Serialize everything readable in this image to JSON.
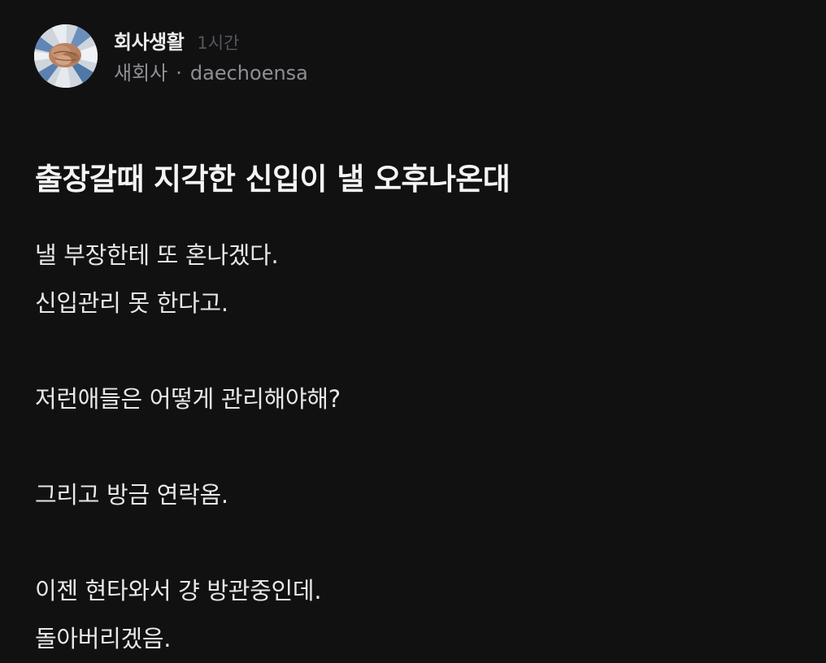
{
  "post": {
    "community": "회사생활",
    "time_ago": "1시간",
    "company": "새회사",
    "separator": "·",
    "author": "daechoensa",
    "title": "출장갈때 지각한 신입이 낼 오후나온대",
    "body_lines": [
      "낼 부장한테 또 혼나겠다.",
      "신입관리 못 한다고.",
      "",
      "저런애들은 어떻게 관리해야해?",
      "",
      "그리고 방금 연락옴.",
      "",
      "이젠 현타와서 걍 방관중인데.",
      "돌아버리겠음."
    ]
  },
  "colors": {
    "background": "#111112",
    "text": "#e8e8eb",
    "muted": "#8d8f95",
    "time": "#55565c"
  }
}
